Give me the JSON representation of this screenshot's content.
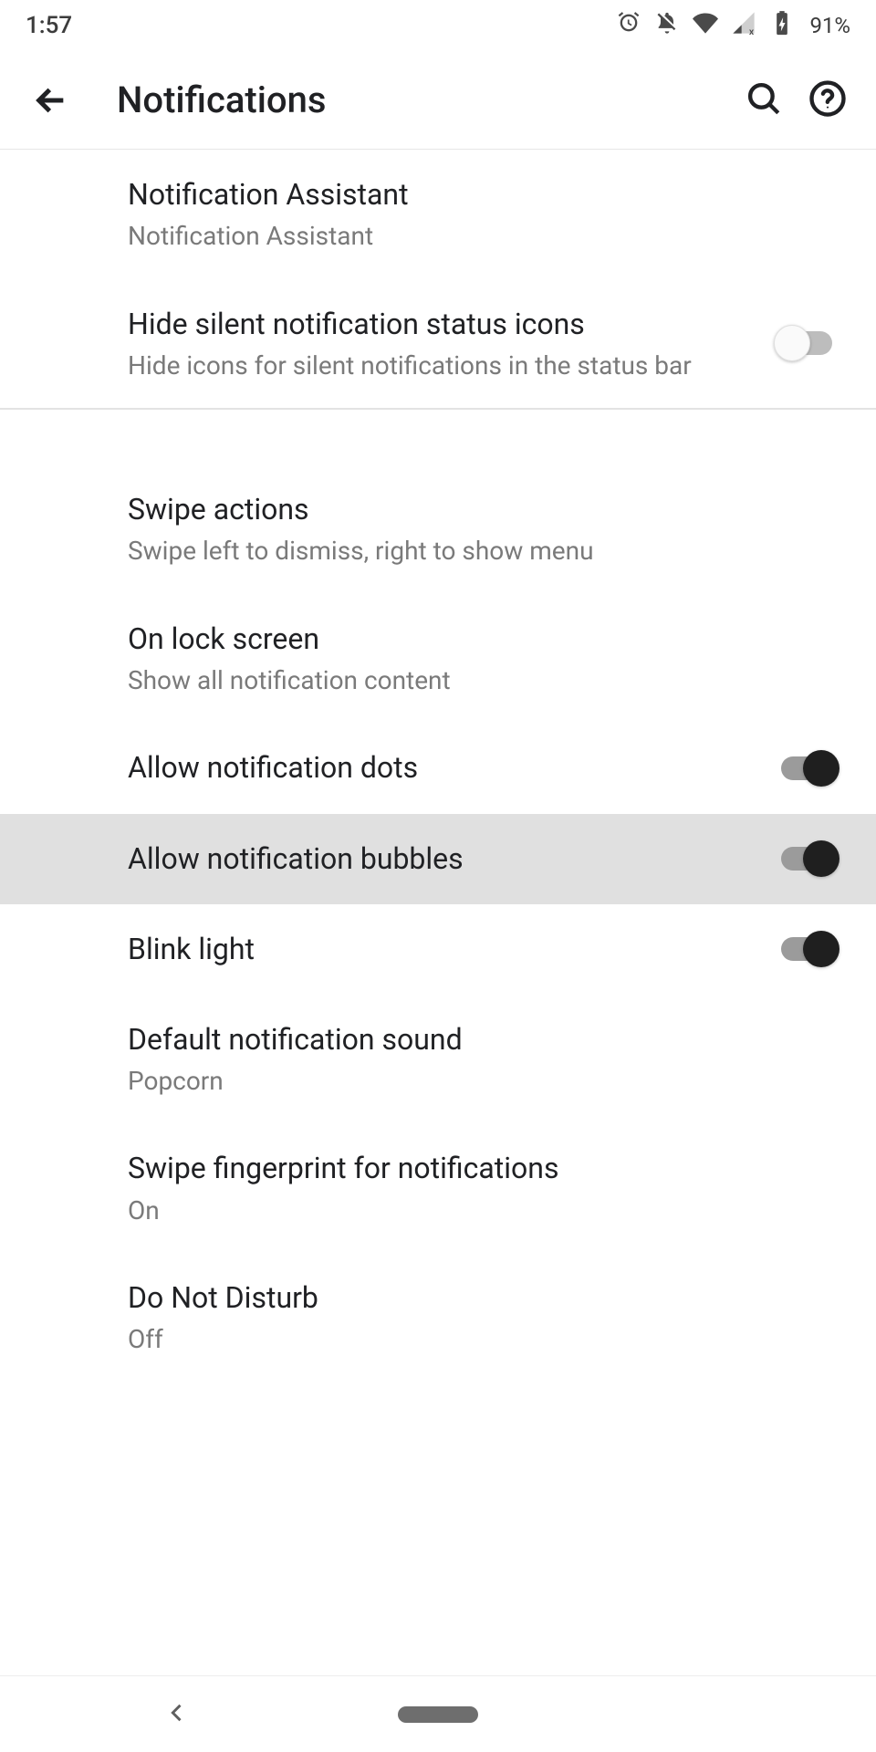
{
  "status": {
    "time": "1:57",
    "battery": "91%"
  },
  "header": {
    "title": "Notifications"
  },
  "group1": {
    "assistant": {
      "title": "Notification Assistant",
      "sub": "Notification Assistant"
    },
    "hide": {
      "title": "Hide silent notification status icons",
      "sub": "Hide icons for silent notifications in the status bar"
    }
  },
  "group2": {
    "swipe": {
      "title": "Swipe actions",
      "sub": "Swipe left to dismiss, right to show menu"
    },
    "lock": {
      "title": "On lock screen",
      "sub": "Show all notification content"
    },
    "dots": {
      "title": "Allow notification dots"
    },
    "bubbles": {
      "title": "Allow notification bubbles"
    },
    "blink": {
      "title": "Blink light"
    },
    "sound": {
      "title": "Default notification sound",
      "sub": "Popcorn"
    },
    "fingerprint": {
      "title": "Swipe fingerprint for notifications",
      "sub": "On"
    },
    "dnd": {
      "title": "Do Not Disturb",
      "sub": "Off"
    }
  }
}
